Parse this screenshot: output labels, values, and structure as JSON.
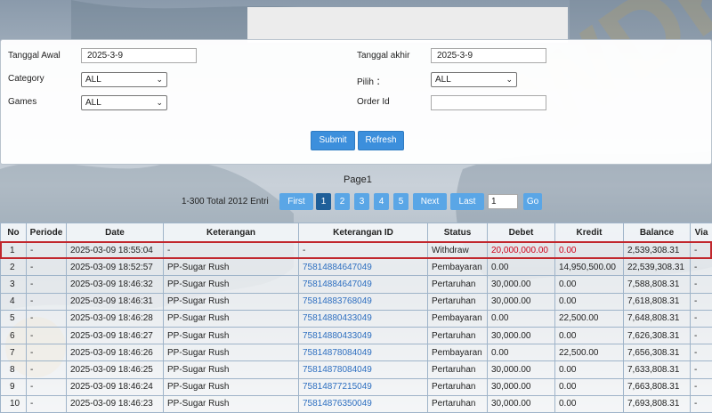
{
  "form": {
    "tanggal_awal_label": "Tanggal Awal",
    "tanggal_awal_value": "2025-3-9",
    "tanggal_akhir_label": "Tanggal akhir",
    "tanggal_akhir_value": "2025-3-9",
    "category_label": "Category",
    "category_value": "ALL",
    "pilih_label": "Pilih ：",
    "pilih_value": "ALL",
    "games_label": "Games",
    "games_value": "ALL",
    "order_id_label": "Order Id",
    "order_id_value": "",
    "submit_label": "Submit",
    "refresh_label": "Refresh"
  },
  "pagination": {
    "page_title": "Page1",
    "entri_text": "1-300 Total 2012 Entri",
    "first_label": "First",
    "pages": [
      "1",
      "2",
      "3",
      "4",
      "5"
    ],
    "active_page": "1",
    "next_label": "Next",
    "last_label": "Last",
    "page_input_value": "1",
    "go_label": "Go"
  },
  "table": {
    "headers": [
      "No",
      "Periode",
      "Date",
      "Keterangan",
      "Keterangan ID",
      "Status",
      "Debet",
      "Kredit",
      "Balance",
      "Via"
    ],
    "rows": [
      [
        "1",
        "-",
        "2025-03-09 18:55:04",
        "-",
        "-",
        "Withdraw",
        "20,000,000.00",
        "0.00",
        "2,539,308.31",
        "-"
      ],
      [
        "2",
        "-",
        "2025-03-09 18:52:57",
        "PP-Sugar Rush",
        "75814884647049",
        "Pembayaran",
        "0.00",
        "14,950,500.00",
        "22,539,308.31",
        "-"
      ],
      [
        "3",
        "-",
        "2025-03-09 18:46:32",
        "PP-Sugar Rush",
        "75814884647049",
        "Pertaruhan",
        "30,000.00",
        "0.00",
        "7,588,808.31",
        "-"
      ],
      [
        "4",
        "-",
        "2025-03-09 18:46:31",
        "PP-Sugar Rush",
        "75814883768049",
        "Pertaruhan",
        "30,000.00",
        "0.00",
        "7,618,808.31",
        "-"
      ],
      [
        "5",
        "-",
        "2025-03-09 18:46:28",
        "PP-Sugar Rush",
        "75814880433049",
        "Pembayaran",
        "0.00",
        "22,500.00",
        "7,648,808.31",
        "-"
      ],
      [
        "6",
        "-",
        "2025-03-09 18:46:27",
        "PP-Sugar Rush",
        "75814880433049",
        "Pertaruhan",
        "30,000.00",
        "0.00",
        "7,626,308.31",
        "-"
      ],
      [
        "7",
        "-",
        "2025-03-09 18:46:26",
        "PP-Sugar Rush",
        "75814878084049",
        "Pembayaran",
        "0.00",
        "22,500.00",
        "7,656,308.31",
        "-"
      ],
      [
        "8",
        "-",
        "2025-03-09 18:46:25",
        "PP-Sugar Rush",
        "75814878084049",
        "Pertaruhan",
        "30,000.00",
        "0.00",
        "7,633,808.31",
        "-"
      ],
      [
        "9",
        "-",
        "2025-03-09 18:46:24",
        "PP-Sugar Rush",
        "75814877215049",
        "Pertaruhan",
        "30,000.00",
        "0.00",
        "7,663,808.31",
        "-"
      ],
      [
        "10",
        "-",
        "2025-03-09 18:46:23",
        "PP-Sugar Rush",
        "75814876350049",
        "Pertaruhan",
        "30,000.00",
        "0.00",
        "7,693,808.31",
        "-"
      ]
    ]
  },
  "colors": {
    "accent": "#3c8fdc",
    "highlight": "#c1272d",
    "link": "#2e6fc0"
  },
  "watermark_text": "WDKUK"
}
